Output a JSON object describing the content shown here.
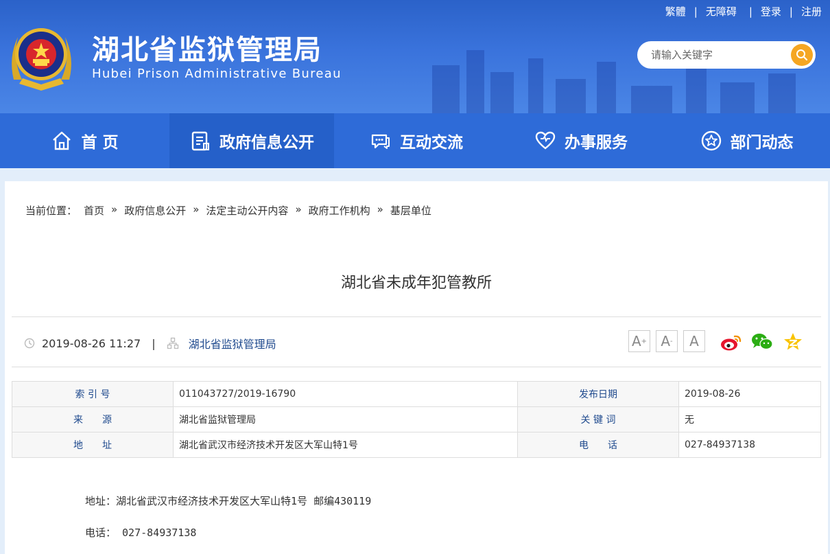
{
  "header": {
    "title": "湖北省监狱管理局",
    "subtitle": "Hubei Prison Administrative Bureau",
    "top_links": [
      "繁體",
      "无障碍",
      "登录",
      "注册"
    ],
    "search_placeholder": "请输入关键字"
  },
  "nav": [
    {
      "label": "首 页",
      "icon": "home-icon"
    },
    {
      "label": "政府信息公开",
      "icon": "document-icon"
    },
    {
      "label": "互动交流",
      "icon": "chat-icon"
    },
    {
      "label": "办事服务",
      "icon": "heart-icon"
    },
    {
      "label": "部门动态",
      "icon": "star-icon"
    }
  ],
  "breadcrumb": {
    "prefix": "当前位置：",
    "items": [
      "首页",
      "政府信息公开",
      "法定主动公开内容",
      "政府工作机构",
      "基层单位"
    ],
    "separator": "»"
  },
  "article": {
    "title": "湖北省未成年犯管教所",
    "date": "2019-08-26 11:27",
    "divider": "|",
    "source": "湖北省监狱管理局"
  },
  "font_size_buttons": [
    "A+",
    "A-",
    "A"
  ],
  "share_icons": [
    "weibo-icon",
    "wechat-icon",
    "qzone-icon"
  ],
  "info_table": [
    {
      "label1": "索 引 号",
      "value1": "011043727/2019-16790",
      "label2": "发布日期",
      "value2": "2019-08-26"
    },
    {
      "label1": "来　　源",
      "value1": "湖北省监狱管理局",
      "label2": "关 键 词",
      "value2": "无"
    },
    {
      "label1": "地　　址",
      "value1": "湖北省武汉市经济技术开发区大军山特1号",
      "label2": "电　　话",
      "value2": "027-84937138"
    }
  ],
  "body": {
    "address_line": "地址：湖北省武汉市经济技术开发区大军山特1号 邮编430119",
    "phone_line": "电话： 027-84937138"
  },
  "colors": {
    "header_blue": "#3a73dc",
    "nav_blue": "#2e6bd8",
    "search_button": "#f5a623",
    "link_blue": "#1f4a8e",
    "weibo": "#e6162d",
    "wechat": "#2bad13",
    "qzone": "#f9c300"
  }
}
